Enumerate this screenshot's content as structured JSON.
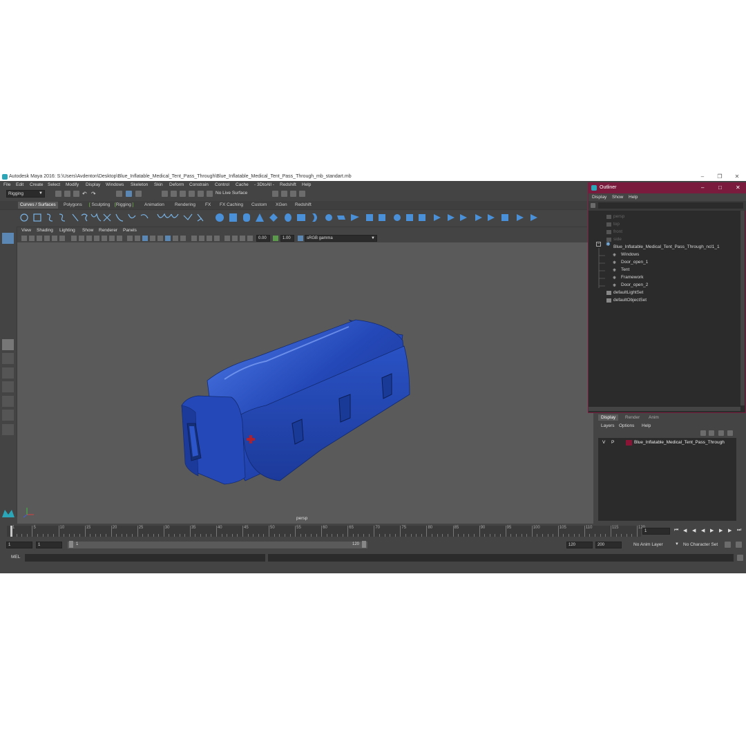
{
  "window": {
    "title": "Autodesk Maya 2016: S:\\Users\\Avdenton\\Desktop\\Blue_Inflatable_Medical_Tent_Pass_Through\\Blue_Inflatable_Medical_Tent_Pass_Through_mb_standart.mb"
  },
  "menubar": [
    "File",
    "Edit",
    "Create",
    "Select",
    "Modify",
    "Display",
    "Windows",
    "Skeleton",
    "Skin",
    "Deform",
    "Constrain",
    "Control",
    "Cache",
    "- 3DtoAll -",
    "Redshift",
    "Help"
  ],
  "statusline": {
    "menuset": "Rigging",
    "live_surface": "No Live Surface"
  },
  "shelf_tabs": [
    "Curves / Surfaces",
    "Polygons",
    "Sculpting",
    "Rigging",
    "Animation",
    "Rendering",
    "FX",
    "FX Caching",
    "Custom",
    "XGen",
    "Redshift"
  ],
  "panel_menu": [
    "View",
    "Shading",
    "Lighting",
    "Show",
    "Renderer",
    "Panels"
  ],
  "panel_toolbar": {
    "exposure": "0.00",
    "gamma": "1.00",
    "colorspace": "sRGB gamma"
  },
  "viewport": {
    "camera_label": "persp"
  },
  "outliner": {
    "title": "Outliner",
    "menu": [
      "Display",
      "Show",
      "Help"
    ],
    "items": [
      {
        "label": "persp",
        "dim": true
      },
      {
        "label": "top",
        "dim": true
      },
      {
        "label": "front",
        "dim": true
      },
      {
        "label": "side",
        "dim": true
      },
      {
        "label": "Blue_Inflatable_Medical_Tent_Pass_Through_ncl1_1",
        "dim": false
      },
      {
        "label": "Windows",
        "dim": false
      },
      {
        "label": "Door_open_1",
        "dim": false
      },
      {
        "label": "Tent",
        "dim": false
      },
      {
        "label": "Framework",
        "dim": false
      },
      {
        "label": "Door_open_2",
        "dim": false
      },
      {
        "label": "defaultLightSet",
        "dim": false
      },
      {
        "label": "defaultObjectSet",
        "dim": false
      }
    ]
  },
  "layer_editor": {
    "tabs": [
      "Display",
      "Render",
      "Anim"
    ],
    "menu": [
      "Layers",
      "Options",
      "Help"
    ],
    "layer": {
      "v": "V",
      "p": "P",
      "name": "Blue_Inflatable_Medical_Tent_Pass_Through",
      "color": "#8a1435"
    }
  },
  "timeslider": {
    "ticks": [
      "1",
      "5",
      "10",
      "15",
      "20",
      "25",
      "30",
      "35",
      "40",
      "45",
      "50",
      "55",
      "60",
      "65",
      "70",
      "75",
      "80",
      "85",
      "90",
      "95",
      "100",
      "105",
      "110",
      "115",
      "120"
    ],
    "current_frame": "1"
  },
  "range": {
    "start": "1",
    "start2": "1",
    "range_start": "1",
    "range_end": "120",
    "end": "120",
    "end2": "200",
    "anim_layer": "No Anim Layer",
    "char_set": "No Character Set"
  },
  "cmdline": {
    "label": "MEL"
  },
  "colors": {
    "tent": "#2448b8",
    "viewport": "#5a5a5a",
    "outliner_title": "#7a1b3d"
  }
}
